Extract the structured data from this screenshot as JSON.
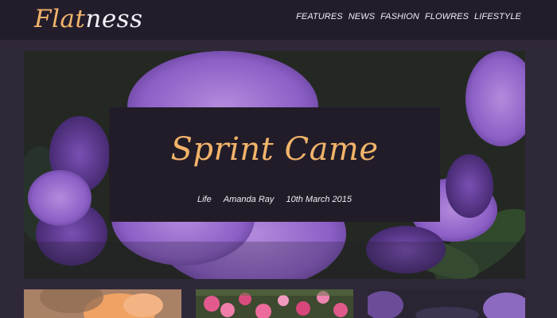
{
  "site": {
    "logo_part1": "Flat",
    "logo_part2": "ness"
  },
  "nav": {
    "items": [
      "FEATURES",
      "NEWS",
      "FASHION",
      "FLOWRES",
      "LIFESTYLE"
    ]
  },
  "hero": {
    "title": "Sprint Came",
    "category": "Life",
    "author": "Amanda Ray",
    "date": "10th March 2015"
  },
  "colors": {
    "accent": "#f2b46a",
    "header_bg": "#231d2b",
    "page_bg": "#2f2838",
    "card_bg": "#221c29",
    "text_light": "#f2eef5"
  }
}
